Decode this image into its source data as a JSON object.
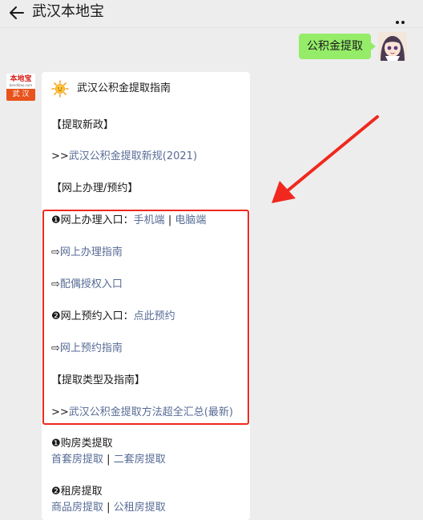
{
  "header": {
    "title": "武汉本地宝",
    "back_icon": "arrow-left-icon",
    "more_icon": "more-dots-icon"
  },
  "outgoing": {
    "text": "公积金提取"
  },
  "bot": {
    "logo_top": "本地宝",
    "logo_mid": "bendibao.com",
    "logo_bottom": "武 汉"
  },
  "card": {
    "icon": "sun-icon",
    "title": "武汉公积金提取指南",
    "section1": "【提取新政】",
    "policy_prefix": ">>",
    "policy_link": "武汉公积金提取新规(2021)",
    "section2": "【网上办理/预约】",
    "online_num": "❶",
    "online_label": "网上办理入口：",
    "online_mobile": "手机端",
    "online_sep": "|",
    "online_pc": "电脑端",
    "guide_prefix": "⇨",
    "online_guide": "网上办理指南",
    "spouse_prefix": "⇨",
    "spouse_auth": "配偶授权入口",
    "appt_num": "❷",
    "appt_label": "网上预约入口：",
    "appt_link": "点此预约",
    "appt_guide_prefix": "⇨",
    "appt_guide": "网上预约指南",
    "section3": "【提取类型及指南】",
    "summary_prefix": ">>",
    "summary_link": "武汉公积金提取方法超全汇总(最新)",
    "buy_num": "❶",
    "buy_label": "购房类提取",
    "buy_first": "首套房提取",
    "buy_sep": "|",
    "buy_second": "二套房提取",
    "rent_num": "❷",
    "rent_label": "租房提取",
    "rent_commercial": "商品房提取",
    "rent_sep": "|",
    "rent_public": "公租房提取"
  },
  "annotation_color": "#f0281e",
  "link_color": "#576b95",
  "bubble_color": "#95ec69"
}
